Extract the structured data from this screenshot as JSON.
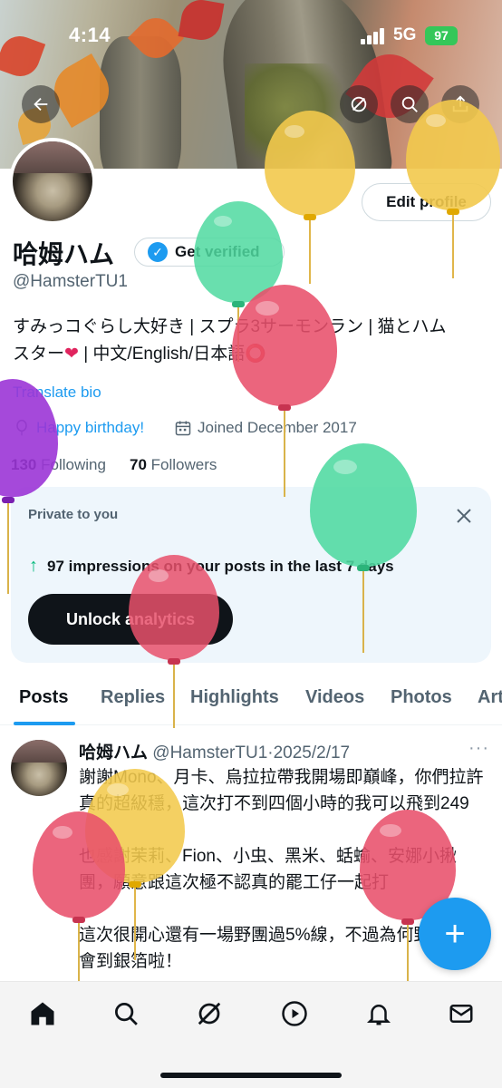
{
  "status_bar": {
    "time": "4:14",
    "network": "5G",
    "battery": "97"
  },
  "profile": {
    "name": "哈姆ハム",
    "verify_label": "Get verified",
    "handle": "@HamsterTU1",
    "edit_label": "Edit profile",
    "bio_line1": "すみっコぐらし大好き | スプラ3サーモンラン | 猫とハム",
    "bio_line2_a": "スター",
    "bio_line2_b": " | 中文/English/日本語",
    "translate_label": "Translate bio",
    "birthday": "Happy birthday!",
    "joined": "Joined December 2017",
    "following_count": "130",
    "following_label": "Following",
    "followers_count": "70",
    "followers_label": "Followers"
  },
  "private_card": {
    "title": "Private to you",
    "impressions": "97 impressions on your posts in the last 7 days",
    "unlock_label": "Unlock analytics"
  },
  "tabs": [
    "Posts",
    "Replies",
    "Highlights",
    "Videos",
    "Photos",
    "Art"
  ],
  "post": {
    "name": "哈姆ハム",
    "handle_date": "@HamsterTU1·2025/2/17",
    "more": "···",
    "para1": "謝謝Mono、月卡、烏拉拉帶我開場即巔峰，你們拉許真的超級穩，這次打不到四個小時的我可以飛到249",
    "para2": "也感謝茉莉、Fion、小虫、黑米、蛞蝓、安娜小揪團，願意跟這次極不認真的罷工仔一起打",
    "para3": "這次很開心還有一場野團過5%線，不過為何野團也都會到銀箔啦！"
  },
  "fab_label": "+",
  "colors": {
    "accent": "#1d9bf0",
    "text_primary": "#0f1419",
    "text_secondary": "#536471",
    "card_bg": "#eef6fc",
    "positive": "#00ba7c",
    "balloon_yellow": "#f2c94c",
    "balloon_red": "#e8506b",
    "balloon_green": "#4fd9a0",
    "balloon_purple": "#9b35d6"
  },
  "icons": {
    "banner": [
      "back-arrow-icon",
      "grok-icon",
      "search-icon",
      "share-icon"
    ],
    "nav": [
      "home-icon",
      "search-icon",
      "grok-icon",
      "video-play-icon",
      "notifications-bell-icon",
      "messages-mail-icon"
    ],
    "meta": [
      "balloon-icon",
      "calendar-icon"
    ]
  }
}
